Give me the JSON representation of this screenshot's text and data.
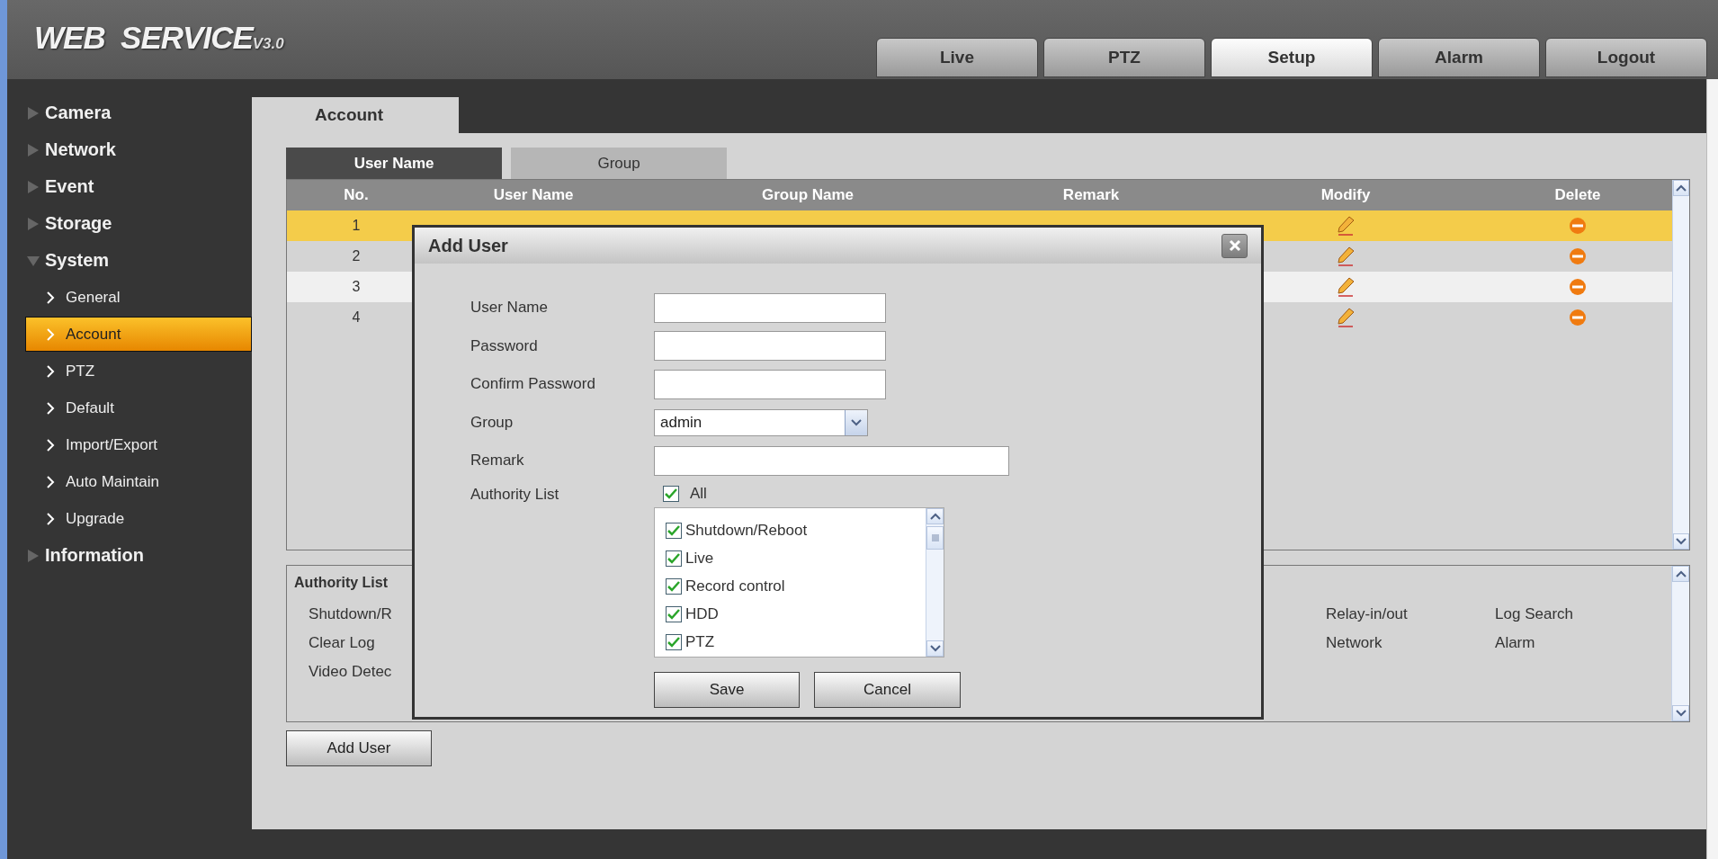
{
  "header": {
    "logo": "WEB  SERVICE",
    "version": "V3.0",
    "tabs": [
      {
        "label": "Live",
        "selected": false
      },
      {
        "label": "PTZ",
        "selected": false
      },
      {
        "label": "Setup",
        "selected": true
      },
      {
        "label": "Alarm",
        "selected": false
      },
      {
        "label": "Logout",
        "selected": false
      }
    ]
  },
  "sidebar": {
    "items": [
      {
        "label": "Camera",
        "expanded": false
      },
      {
        "label": "Network",
        "expanded": false
      },
      {
        "label": "Event",
        "expanded": false
      },
      {
        "label": "Storage",
        "expanded": false
      },
      {
        "label": "System",
        "expanded": true,
        "children": [
          {
            "label": "General",
            "selected": false
          },
          {
            "label": "Account",
            "selected": true
          },
          {
            "label": "PTZ",
            "selected": false
          },
          {
            "label": "Default",
            "selected": false
          },
          {
            "label": "Import/Export",
            "selected": false
          },
          {
            "label": "Auto Maintain",
            "selected": false
          },
          {
            "label": "Upgrade",
            "selected": false
          }
        ]
      },
      {
        "label": "Information",
        "expanded": false
      }
    ]
  },
  "page_tab": "Account",
  "subtabs": [
    {
      "label": "User Name",
      "selected": true
    },
    {
      "label": "Group",
      "selected": false
    }
  ],
  "table": {
    "columns": [
      "No.",
      "User Name",
      "Group Name",
      "Remark",
      "Modify",
      "Delete"
    ],
    "rows": [
      {
        "no": "1",
        "selected": true
      },
      {
        "no": "2",
        "selected": false
      },
      {
        "no": "3",
        "selected": false
      },
      {
        "no": "4",
        "selected": false
      }
    ]
  },
  "authority_panel": {
    "title": "Authority List",
    "columns": [
      [
        "Shutdown/R",
        "Clear Log",
        "Video Detec"
      ],
      [
        "Relay-in/out",
        "Network"
      ],
      [
        "Log Search",
        "Alarm"
      ]
    ]
  },
  "add_user_button": "Add User",
  "dialog": {
    "title": "Add User",
    "fields": [
      {
        "kind": "text",
        "label": "User Name",
        "wide": false
      },
      {
        "kind": "text",
        "label": "Password",
        "wide": false
      },
      {
        "kind": "text",
        "label": "Confirm Password",
        "wide": false
      },
      {
        "kind": "select",
        "label": "Group",
        "value": "admin",
        "wide": false
      },
      {
        "kind": "text",
        "label": "Remark",
        "wide": true
      }
    ],
    "authority": {
      "label": "Authority List",
      "all": {
        "label": "All",
        "checked": true
      },
      "items": [
        {
          "label": "Shutdown/Reboot",
          "checked": true
        },
        {
          "label": "Live",
          "checked": true
        },
        {
          "label": "Record control",
          "checked": true
        },
        {
          "label": "HDD",
          "checked": true
        },
        {
          "label": "PTZ",
          "checked": true
        }
      ]
    },
    "buttons": [
      "Save",
      "Cancel"
    ]
  }
}
